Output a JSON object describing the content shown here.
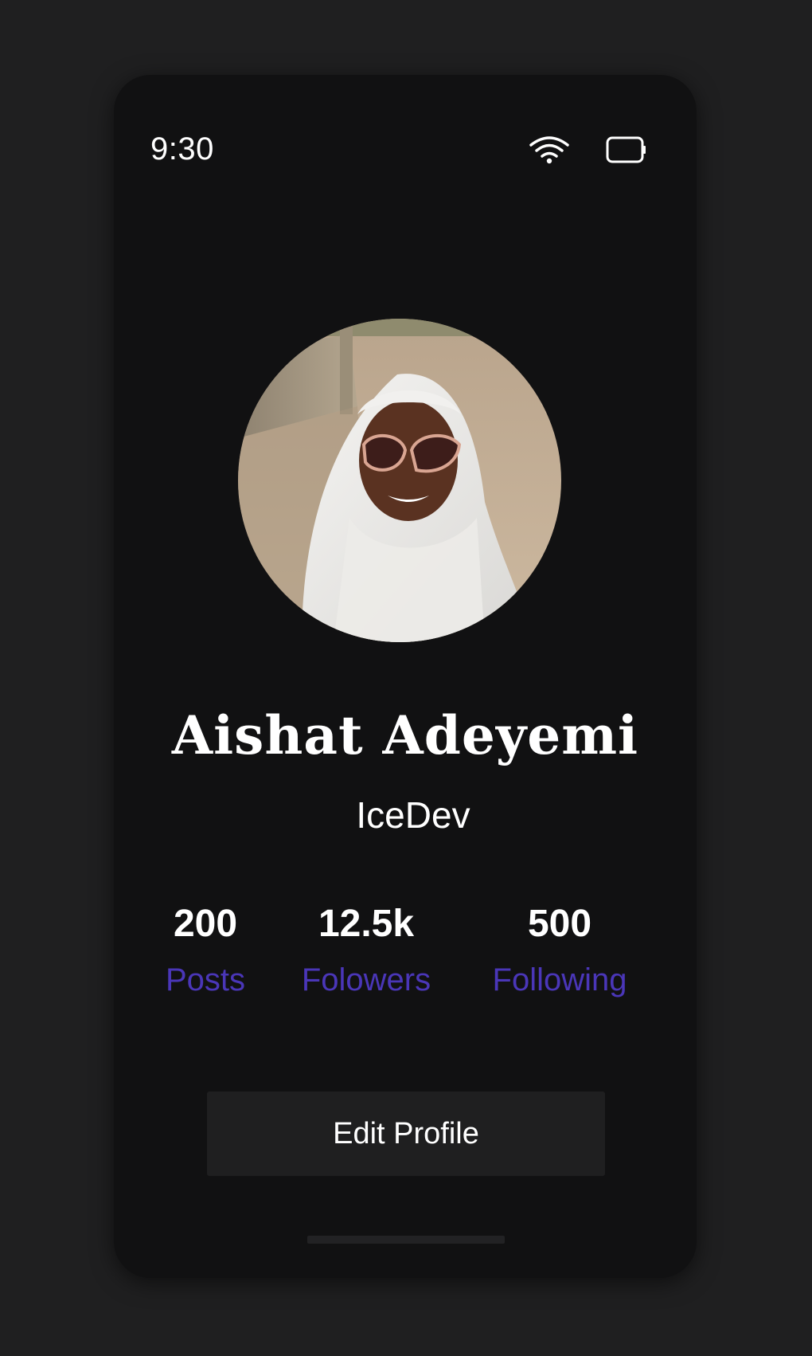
{
  "status_bar": {
    "time": "9:30",
    "wifi_icon": "wifi-icon",
    "battery_icon": "battery-icon"
  },
  "profile": {
    "avatar_alt": "profile-photo",
    "name": "Aishat Adeyemi",
    "handle": "IceDev"
  },
  "stats": [
    {
      "value": "200",
      "label": "Posts"
    },
    {
      "value": "12.5k",
      "label": "Folowers"
    },
    {
      "value": "500",
      "label": "Following"
    }
  ],
  "actions": {
    "edit_profile_label": "Edit Profile"
  },
  "colors": {
    "background": "#1f1f20",
    "screen": "#111112",
    "accent": "#4a36b8",
    "button": "#1f1f20"
  }
}
